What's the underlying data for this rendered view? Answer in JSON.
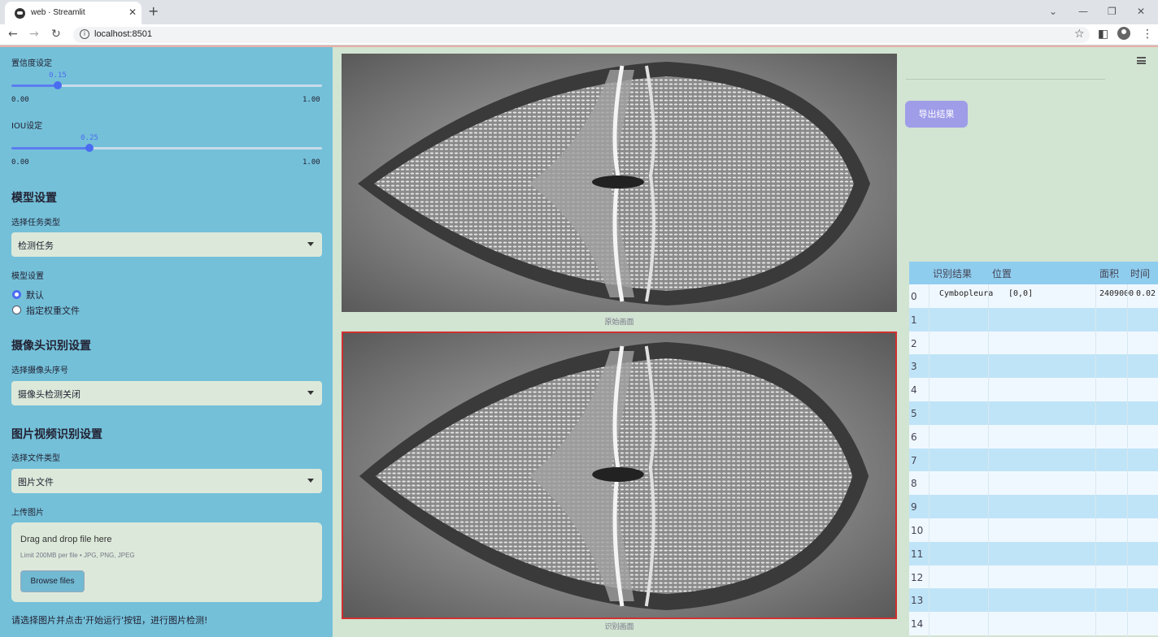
{
  "browser": {
    "tab_title": "web · Streamlit",
    "url": "localhost:8501"
  },
  "sidebar": {
    "confidence": {
      "label": "置信度设定",
      "value": "0.15",
      "level": 0.15,
      "min": "0.00",
      "max": "1.00"
    },
    "iou": {
      "label": "IOU设定",
      "value": "0.25",
      "level": 0.25,
      "min": "0.00",
      "max": "1.00"
    },
    "model_section": {
      "title": "模型设置",
      "task_label": "选择任务类型",
      "task_value": "检测任务",
      "model_label": "模型设置",
      "options": [
        "默认",
        "指定权重文件"
      ],
      "selected_option": 0
    },
    "camera_section": {
      "title": "摄像头识别设置",
      "camera_label": "选择摄像头序号",
      "camera_value": "摄像头检测关闭"
    },
    "media_section": {
      "title": "图片视频识别设置",
      "filetype_label": "选择文件类型",
      "filetype_value": "图片文件",
      "upload_label": "上传图片",
      "drop_text": "Drag and drop file here",
      "limit_text": "Limit 200MB per file • JPG, PNG, JPEG",
      "browse_label": "Browse files"
    },
    "hint": "请选择图片并点击'开始运行'按钮，进行图片检测!"
  },
  "main": {
    "original_caption": "原始画面",
    "result_caption": "识别画面",
    "export_label": "导出结果"
  },
  "table": {
    "columns": [
      "识别结果",
      "位置",
      "面积",
      "时间"
    ],
    "rows": [
      {
        "index": "0",
        "result": "Cymbopleura",
        "position": "[0,0]",
        "area": "2409000",
        "time": "0.02"
      },
      {
        "index": "1"
      },
      {
        "index": "2"
      },
      {
        "index": "3"
      },
      {
        "index": "4"
      },
      {
        "index": "5"
      },
      {
        "index": "6"
      },
      {
        "index": "7"
      },
      {
        "index": "8"
      },
      {
        "index": "9"
      },
      {
        "index": "10"
      },
      {
        "index": "11"
      },
      {
        "index": "12"
      },
      {
        "index": "13"
      },
      {
        "index": "14"
      }
    ]
  },
  "colors": {
    "sidebar_bg": "#74c0d9",
    "main_bg": "#d2e4d2",
    "slider_accent": "#4a6cf0",
    "export_button": "#9f9ce8",
    "table_header": "#8fcdee",
    "result_border": "#d03030"
  }
}
